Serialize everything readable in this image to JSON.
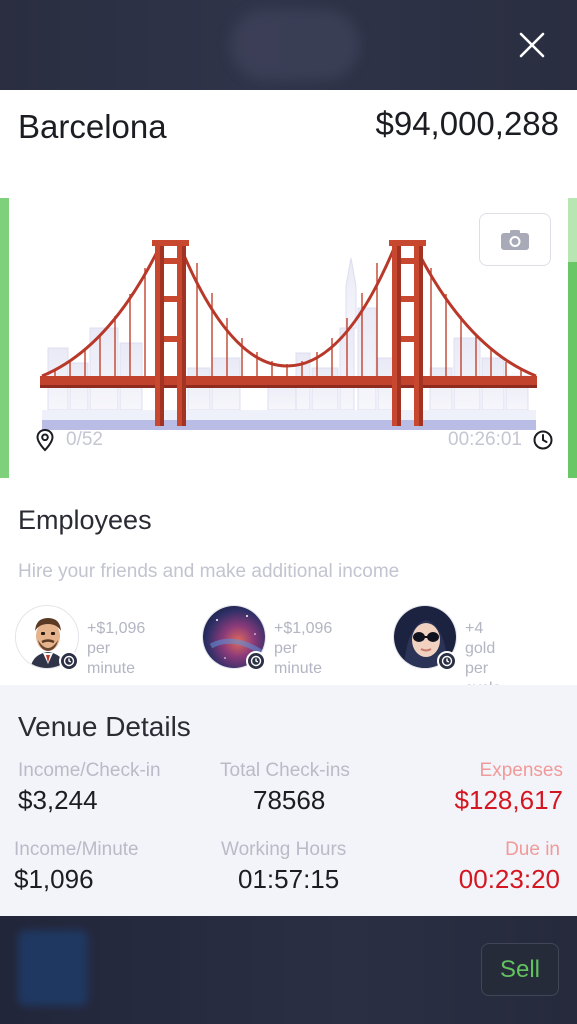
{
  "header": {
    "venue_name": "Barcelona",
    "venue_value": "$94,000,288"
  },
  "scene": {
    "checkin_count": "0/52",
    "timer": "00:26:01",
    "progress_fraction": 0.77,
    "icons": [
      "close-icon",
      "camera-icon",
      "location-pin-icon",
      "clock-icon",
      "bridge-illustration"
    ]
  },
  "employees": {
    "title": "Employees",
    "subtitle": "Hire your friends and make additional income",
    "items": [
      {
        "avatar": "avatar-man-suit",
        "line1": "+$1,096 per",
        "line2": "minute"
      },
      {
        "avatar": "avatar-galaxy",
        "line1": "+$1,096 per",
        "line2": "minute"
      },
      {
        "avatar": "avatar-woman-sunglasses",
        "line1": "+4 gold per",
        "line2": "cycle"
      }
    ]
  },
  "venue_details": {
    "title": "Venue Details",
    "income_checkin_label": "Income/Check-in",
    "income_checkin_value": "$3,244",
    "total_checkins_label": "Total Check-ins",
    "total_checkins_value": "78568",
    "expenses_label": "Expenses",
    "expenses_value": "$128,617",
    "income_minute_label": "Income/Minute",
    "income_minute_value": "$1,096",
    "working_hours_label": "Working Hours",
    "working_hours_value": "01:57:15",
    "due_in_label": "Due in",
    "due_in_value": "00:23:20"
  },
  "bottom": {
    "sell_label": "Sell"
  },
  "colors": {
    "accent_green": "#62c25e",
    "alert_red": "#d41621",
    "bridge_red": "#c2432d",
    "dark_bg": "#2a2e40"
  }
}
